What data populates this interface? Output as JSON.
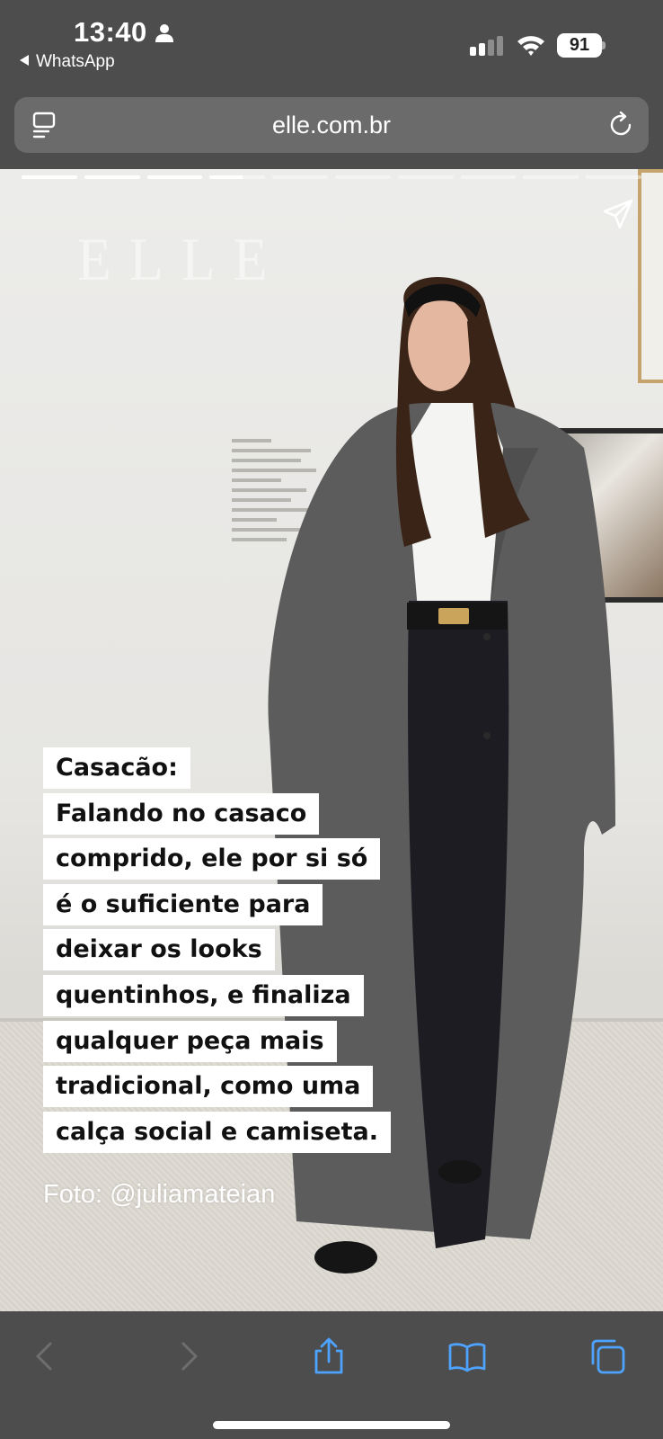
{
  "status_bar": {
    "time": "13:40",
    "back_app_label": "WhatsApp",
    "battery_level": "91"
  },
  "address_bar": {
    "url": "elle.com.br"
  },
  "story": {
    "progress_segments": [
      1,
      1,
      1,
      0.6,
      0,
      0,
      0,
      0,
      0,
      0
    ],
    "brand": "ELLE",
    "caption_lines": [
      "Casacão:",
      "Falando no casaco",
      "comprido, ele por si só",
      "é o suficiente para",
      "deixar os looks",
      "quentinhos, e finaliza",
      "qualquer peça mais",
      "tradicional, como uma",
      "calça social e camiseta."
    ],
    "photo_credit": "Foto: @juliamateian"
  },
  "toolbar": {
    "icons": [
      "back-icon",
      "forward-icon",
      "share-icon",
      "bookmarks-icon",
      "tabs-icon"
    ]
  },
  "colors": {
    "chrome": "#4d4d4d",
    "urlbar": "#6b6b6b",
    "accent_icons": "#4da3ff"
  }
}
